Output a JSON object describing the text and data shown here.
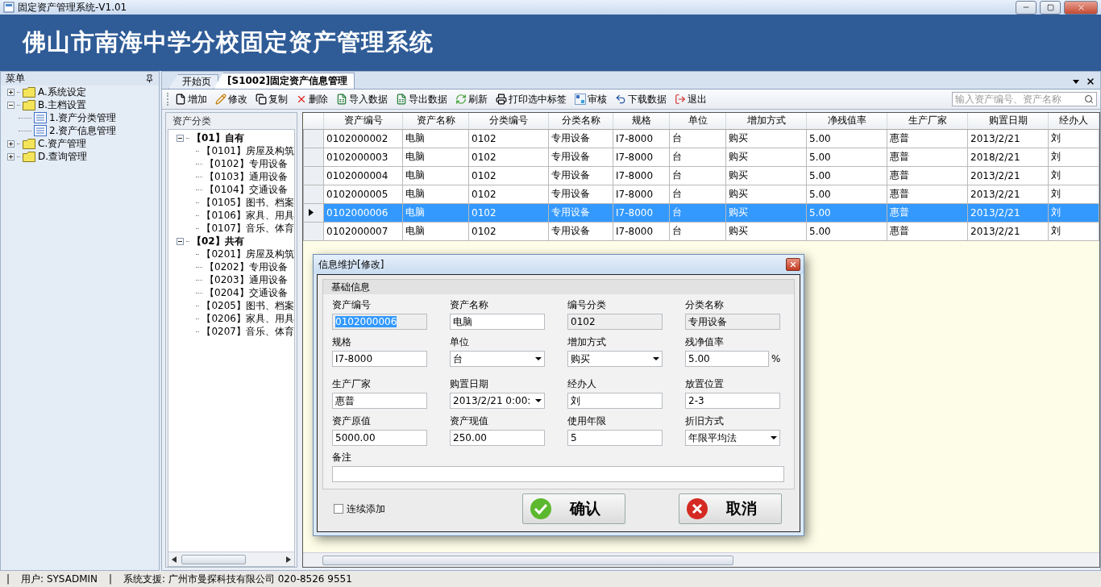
{
  "window": {
    "title": "固定资产管理系统-V1.01"
  },
  "banner": {
    "title": "佛山市南海中学分校固定资产管理系统"
  },
  "sidebar": {
    "title": "菜单",
    "items": [
      {
        "label": "A.系统设定",
        "expanded": false
      },
      {
        "label": "B.主档设置",
        "expanded": true,
        "children": [
          {
            "label": "1.资产分类管理"
          },
          {
            "label": "2.资产信息管理"
          }
        ]
      },
      {
        "label": "C.资产管理",
        "expanded": false
      },
      {
        "label": "D.查询管理",
        "expanded": false
      }
    ]
  },
  "tabs": [
    {
      "label": "开始页",
      "selected": false
    },
    {
      "label": "[S1002]固定资产信息管理",
      "selected": true
    }
  ],
  "toolbar": {
    "items": [
      {
        "kind": "add",
        "label": "增加"
      },
      {
        "kind": "edit",
        "label": "修改"
      },
      {
        "kind": "copy",
        "label": "复制"
      },
      {
        "kind": "delete",
        "label": "删除"
      },
      {
        "kind": "import",
        "label": "导入数据"
      },
      {
        "kind": "export",
        "label": "导出数据"
      },
      {
        "kind": "refresh",
        "label": "刷新"
      },
      {
        "kind": "print",
        "label": "打印选中标签"
      },
      {
        "kind": "audit",
        "label": "审核"
      },
      {
        "kind": "download",
        "label": "下载数据"
      },
      {
        "kind": "exit",
        "label": "退出"
      }
    ],
    "search": {
      "placeholder": "输入资产编号、资产名称"
    }
  },
  "category_tree": {
    "title": "资产分类",
    "items": [
      {
        "label": "【01】自有",
        "expanded": true,
        "children": [
          {
            "label": "【0101】房屋及构筑"
          },
          {
            "label": "【0102】专用设备"
          },
          {
            "label": "【0103】通用设备"
          },
          {
            "label": "【0104】交通设备"
          },
          {
            "label": "【0105】图书、档案"
          },
          {
            "label": "【0106】家具、用具"
          },
          {
            "label": "【0107】音乐、体育"
          }
        ]
      },
      {
        "label": "【02】共有",
        "expanded": true,
        "children": [
          {
            "label": "【0201】房屋及构筑"
          },
          {
            "label": "【0202】专用设备"
          },
          {
            "label": "【0203】通用设备"
          },
          {
            "label": "【0204】交通设备"
          },
          {
            "label": "【0205】图书、档案"
          },
          {
            "label": "【0206】家具、用具"
          },
          {
            "label": "【0207】音乐、体育"
          }
        ]
      }
    ]
  },
  "table": {
    "columns": [
      "资产编号",
      "资产名称",
      "分类编号",
      "分类名称",
      "规格",
      "单位",
      "增加方式",
      "净残值率",
      "生产厂家",
      "购置日期",
      "经办人"
    ],
    "rows": [
      {
        "selected": false,
        "cells": [
          "0102000002",
          "电脑",
          "0102",
          "专用设备",
          "I7-8000",
          "台",
          "购买",
          "5.00",
          "惠普",
          "2013/2/21",
          "刘"
        ]
      },
      {
        "selected": false,
        "cells": [
          "0102000003",
          "电脑",
          "0102",
          "专用设备",
          "I7-8000",
          "台",
          "购买",
          "5.00",
          "惠普",
          "2018/2/21",
          "刘"
        ]
      },
      {
        "selected": false,
        "cells": [
          "0102000004",
          "电脑",
          "0102",
          "专用设备",
          "I7-8000",
          "台",
          "购买",
          "5.00",
          "惠普",
          "2013/2/21",
          "刘"
        ]
      },
      {
        "selected": false,
        "cells": [
          "0102000005",
          "电脑",
          "0102",
          "专用设备",
          "I7-8000",
          "台",
          "购买",
          "5.00",
          "惠普",
          "2013/2/21",
          "刘"
        ]
      },
      {
        "selected": true,
        "cells": [
          "0102000006",
          "电脑",
          "0102",
          "专用设备",
          "I7-8000",
          "台",
          "购买",
          "5.00",
          "惠普",
          "2013/2/21",
          "刘"
        ]
      },
      {
        "selected": false,
        "cells": [
          "0102000007",
          "电脑",
          "0102",
          "专用设备",
          "I7-8000",
          "台",
          "购买",
          "5.00",
          "惠普",
          "2013/2/21",
          "刘"
        ]
      }
    ]
  },
  "dialog": {
    "title": "信息维护[修改]",
    "group": "基础信息",
    "fields": [
      {
        "label": "资产编号",
        "value": "0102000006",
        "kind": "readonly",
        "text_selected": true
      },
      {
        "label": "资产名称",
        "value": "电脑",
        "kind": "text",
        "text_selected": false
      },
      {
        "label": "编号分类",
        "value": "0102",
        "kind": "readonly",
        "text_selected": false
      },
      {
        "label": "分类名称",
        "value": "专用设备",
        "kind": "readonly",
        "text_selected": false
      },
      {
        "label": "规格",
        "value": "I7-8000",
        "kind": "text",
        "text_selected": false
      },
      {
        "label": "单位",
        "value": "台",
        "kind": "select",
        "text_selected": false
      },
      {
        "label": "增加方式",
        "value": "购买",
        "kind": "select",
        "text_selected": false
      },
      {
        "label": "残净值率",
        "value": "5.00",
        "kind": "text",
        "suffix": "%",
        "text_selected": false
      },
      {
        "label": "生产厂家",
        "value": "惠普",
        "kind": "text",
        "text_selected": false
      },
      {
        "label": "购置日期",
        "value": "2013/2/21 0:00:",
        "kind": "select",
        "text_selected": false
      },
      {
        "label": "经办人",
        "value": "刘",
        "kind": "text",
        "text_selected": false
      },
      {
        "label": "放置位置",
        "value": "2-3",
        "kind": "text",
        "text_selected": false
      },
      {
        "label": "资产原值",
        "value": "5000.00",
        "kind": "text",
        "text_selected": false
      },
      {
        "label": "资产现值",
        "value": "250.00",
        "kind": "text",
        "text_selected": false
      },
      {
        "label": "使用年限",
        "value": "5",
        "kind": "text",
        "text_selected": false
      },
      {
        "label": "折旧方式",
        "value": "年限平均法",
        "kind": "select",
        "text_selected": false
      }
    ],
    "remarks": {
      "label": "备注"
    },
    "continuous_add": {
      "label": "连续添加",
      "checked": false
    },
    "buttons": [
      {
        "kind": "confirm",
        "label": "确认"
      },
      {
        "kind": "cancel",
        "label": "取消"
      }
    ]
  },
  "status_bar": {
    "items": [
      "|",
      "用户: SYSADMIN",
      "|",
      "系统支援: 广州市曼探科技有限公司 020-8526 9551"
    ]
  }
}
